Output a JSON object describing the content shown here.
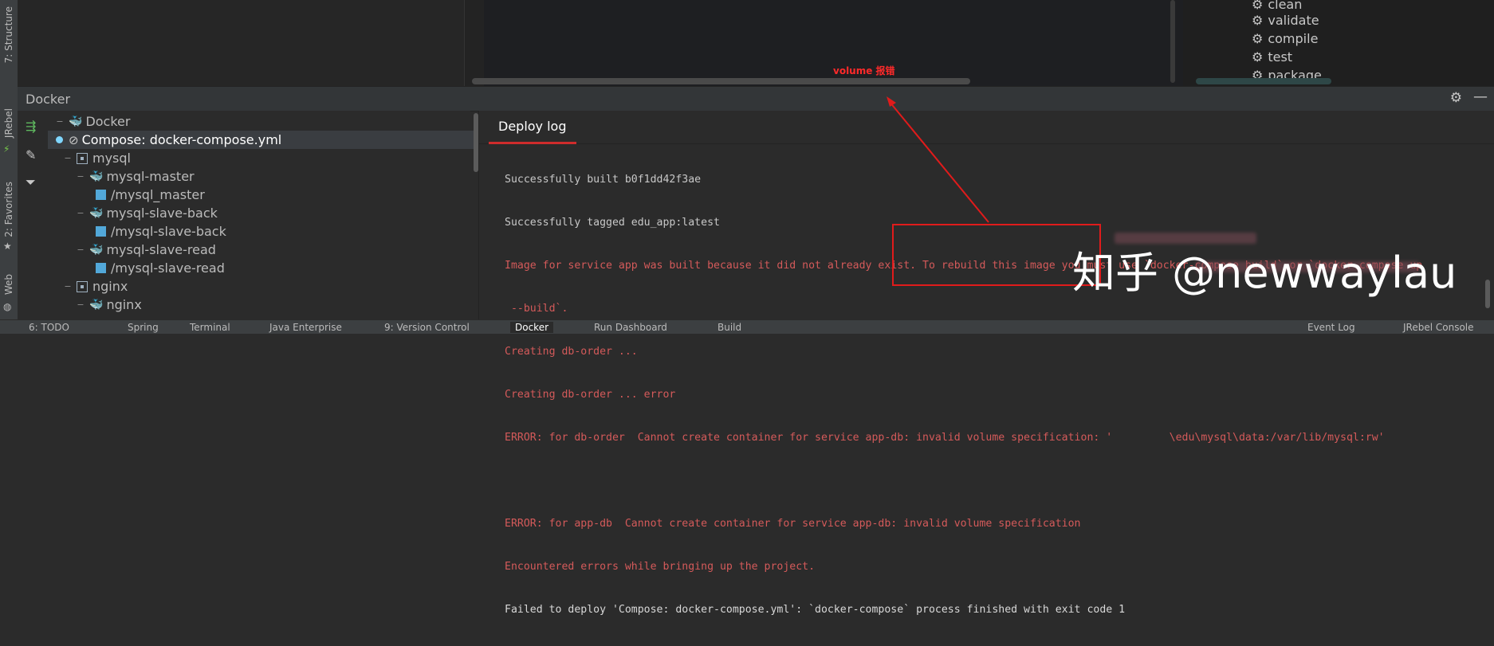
{
  "left_strip": {
    "tabs": [
      {
        "label": "7: Structure",
        "icon": "structure-icon"
      },
      {
        "label": "JRebel",
        "icon": "jrebel-icon"
      },
      {
        "label": "2: Favorites",
        "icon": "star-icon"
      },
      {
        "label": "Web",
        "icon": "web-icon"
      }
    ]
  },
  "maven": {
    "items": [
      "clean",
      "validate",
      "compile",
      "test",
      "package"
    ]
  },
  "annotation": {
    "label": "volume 报错",
    "color": "#ff2a2a"
  },
  "docker": {
    "title": "Docker",
    "tree": {
      "root": "Docker",
      "compose": "Compose: docker-compose.yml",
      "groups": [
        {
          "name": "mysql",
          "services": [
            {
              "name": "mysql-master",
              "volume": "/mysql_master"
            },
            {
              "name": "mysql-slave-back",
              "volume": "/mysql-slave-back"
            },
            {
              "name": "mysql-slave-read",
              "volume": "/mysql-slave-read"
            }
          ]
        },
        {
          "name": "nginx",
          "services": [
            {
              "name": "nginx",
              "volume": ""
            }
          ]
        }
      ]
    },
    "log": {
      "tab": "Deploy log",
      "lines": [
        {
          "text": "Successfully built b0f1dd42f3ae",
          "kind": "info"
        },
        {
          "text": "Successfully tagged edu_app:latest",
          "kind": "info"
        },
        {
          "text": "Image for service app was built because it did not already exist. To rebuild this image you must use `docker-compose build` or `docker-compose up",
          "kind": "error"
        },
        {
          "text": " --build`.",
          "kind": "error"
        },
        {
          "text": "Creating db-order ...",
          "kind": "error"
        },
        {
          "text": "Creating db-order ... error",
          "kind": "error"
        },
        {
          "text": "ERROR: for db-order  Cannot create container for service app-db: invalid volume specification: '         \\edu\\mysql\\data:/var/lib/mysql:rw'",
          "kind": "error"
        },
        {
          "text": "",
          "kind": "error"
        },
        {
          "text": "ERROR: for app-db  Cannot create container for service app-db: invalid volume specification",
          "kind": "error"
        },
        {
          "text": "Encountered errors while bringing up the project.",
          "kind": "error"
        },
        {
          "text": "Failed to deploy 'Compose: docker-compose.yml': `docker-compose` process finished with exit code 1",
          "kind": "plain"
        }
      ]
    }
  },
  "watermark": "知乎 @newwaylau",
  "bottom_bar": {
    "items": [
      "6: TODO",
      "Spring",
      "Terminal",
      "Java Enterprise",
      "9: Version Control",
      "Docker",
      "Run Dashboard",
      "Build",
      "Event Log",
      "JRebel Console"
    ],
    "active": "Docker"
  },
  "colors": {
    "error_text": "#d45a5a",
    "accent_tab": "#cf2c2c",
    "highlight": "#e01b1b"
  }
}
